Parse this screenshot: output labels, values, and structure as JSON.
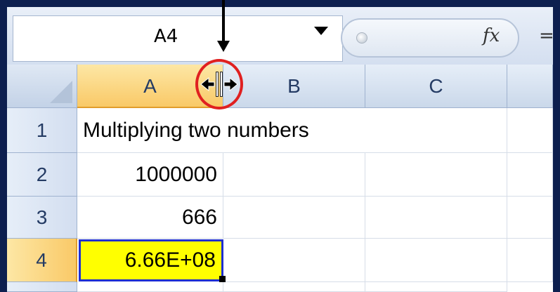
{
  "formula_bar": {
    "name_box_value": "A4",
    "fx_label": "fx",
    "equals_sign": "="
  },
  "columns": [
    {
      "label": "A",
      "active": true
    },
    {
      "label": "B",
      "active": false
    },
    {
      "label": "C",
      "active": false
    }
  ],
  "rows": [
    {
      "label": "1",
      "active": false
    },
    {
      "label": "2",
      "active": false
    },
    {
      "label": "3",
      "active": false
    },
    {
      "label": "4",
      "active": true
    }
  ],
  "cells": {
    "A1": "Multiplying two numbers",
    "A2": "1000000",
    "A3": "666",
    "A4": "6.66E+08"
  },
  "colors": {
    "border": "#0d1f4f",
    "selected_cell_fill": "#ffff00",
    "selected_cell_border": "#1f2fd0",
    "active_header": "#f9c967",
    "annotation_circle": "#e02020"
  },
  "icons": [
    "name-box-dropdown-icon",
    "formula-fx-icon",
    "column-resize-cursor-icon",
    "annotation-arrow-icon"
  ]
}
